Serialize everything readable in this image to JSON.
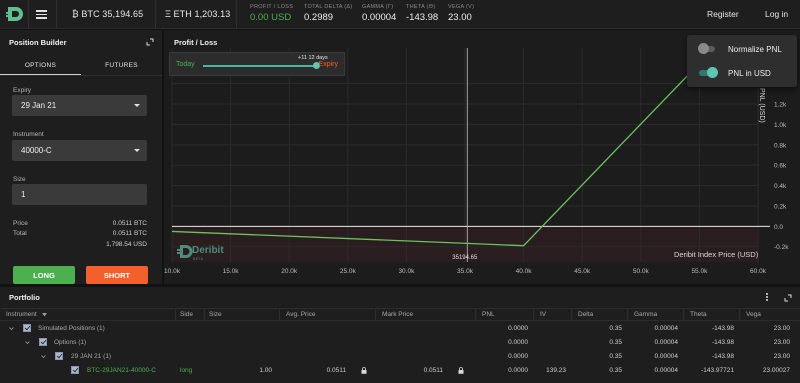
{
  "header": {
    "btc_price": "35,194.65",
    "btc_prefix": "₿ BTC",
    "eth_price": "1,203.13",
    "eth_prefix": "Ξ ETH",
    "stats": [
      {
        "label": "PROFIT / LOSS",
        "value": "0.00 USD",
        "color": "#4caf50"
      },
      {
        "label": "TOTAL DELTA (Δ)",
        "value": "0.2989"
      },
      {
        "label": "GAMMA (Γ)",
        "value": "0.00004"
      },
      {
        "label": "THETA (Θ)",
        "value": "-143.98"
      },
      {
        "label": "VEGA (V)",
        "value": "23.00"
      }
    ],
    "register_label": "Register",
    "login_label": "Log in"
  },
  "position_builder": {
    "title": "Position Builder",
    "tabs": [
      "OPTIONS",
      "FUTURES"
    ],
    "active_tab": "OPTIONS",
    "expiry_label": "Expiry",
    "expiry_value": "29 Jan 21",
    "instrument_label": "Instrument",
    "instrument_value": "40000-C",
    "size_label": "Size",
    "size_value": "1",
    "price_label": "Price",
    "price_value": "0.0511 BTC",
    "total_label": "Total",
    "total_btc": "0.0511 BTC",
    "total_usd": "1,798.54 USD",
    "long_label": "LONG",
    "short_label": "SHORT"
  },
  "pnl_chart": {
    "title": "Profit / Loss",
    "slider": {
      "today_label": "Today",
      "expiry_label": "Expiry",
      "tag": "+11 12 days",
      "position": 0.95
    },
    "index_price_marker": "35194.65",
    "x_axis_label": "Deribit Index Price   (USD)",
    "y_axis_label": "PNL (USD)",
    "brand": "Deribit",
    "brand_sub": "BETA",
    "options": [
      {
        "label": "Normalize PNL",
        "on": false
      },
      {
        "label": "PNL in USD",
        "on": true
      }
    ]
  },
  "chart_data": {
    "type": "line",
    "title": "Profit / Loss",
    "xlabel": "Deribit Index Price (USD)",
    "ylabel": "PNL (USD)",
    "x_ticks": [
      "10.0k",
      "15.0k",
      "20.0k",
      "25.0k",
      "30.0k",
      "35.0k",
      "40.0k",
      "45.0k",
      "50.0k",
      "55.0k",
      "60.0k"
    ],
    "y_ticks": [
      "1.4k",
      "1.2k",
      "1.0k",
      "0.8k",
      "0.6k",
      "0.4k",
      "0.2k",
      "0.0",
      "-0.2k"
    ],
    "xlim": [
      10000,
      60000
    ],
    "ylim": [
      -0.35,
      1.75
    ],
    "series": [
      {
        "color": "#6ac261",
        "x": [
          10000,
          40000,
          55000
        ],
        "y": [
          -0.05,
          -0.19,
          1.6
        ]
      }
    ],
    "current_index": 35194.65
  },
  "portfolio": {
    "title": "Portfolio",
    "columns": [
      "Instrument",
      "Side",
      "Size",
      "Avg. Price",
      "Mark Price",
      "PNL",
      "IV",
      "Delta",
      "Gamma",
      "Theta",
      "Vega"
    ],
    "rows": [
      {
        "label": "Simulated Positions (1)",
        "side": "",
        "size": "",
        "avg": "",
        "mark": "",
        "pnl": "0.0000",
        "iv": "",
        "delta": "0.35",
        "gamma": "0.00004",
        "theta": "-143.98",
        "vega": "23.00"
      },
      {
        "label": "Options (1)",
        "side": "",
        "size": "",
        "avg": "",
        "mark": "",
        "pnl": "0.0000",
        "iv": "",
        "delta": "0.35",
        "gamma": "0.00004",
        "theta": "-143.98",
        "vega": "23.00"
      },
      {
        "label": "29 JAN 21 (1)",
        "side": "",
        "size": "",
        "avg": "",
        "mark": "",
        "pnl": "0.0000",
        "iv": "",
        "delta": "0.35",
        "gamma": "0.00004",
        "theta": "-143.98",
        "vega": "23.00"
      },
      {
        "label": "BTC-29JAN21-40000-C",
        "side": "long",
        "size": "1.00",
        "avg": "0.0511",
        "mark": "0.0511",
        "pnl": "0.0000",
        "iv": "139.23",
        "delta": "0.35",
        "gamma": "0.00004",
        "theta": "-143.97721",
        "vega": "23.00027"
      }
    ]
  }
}
